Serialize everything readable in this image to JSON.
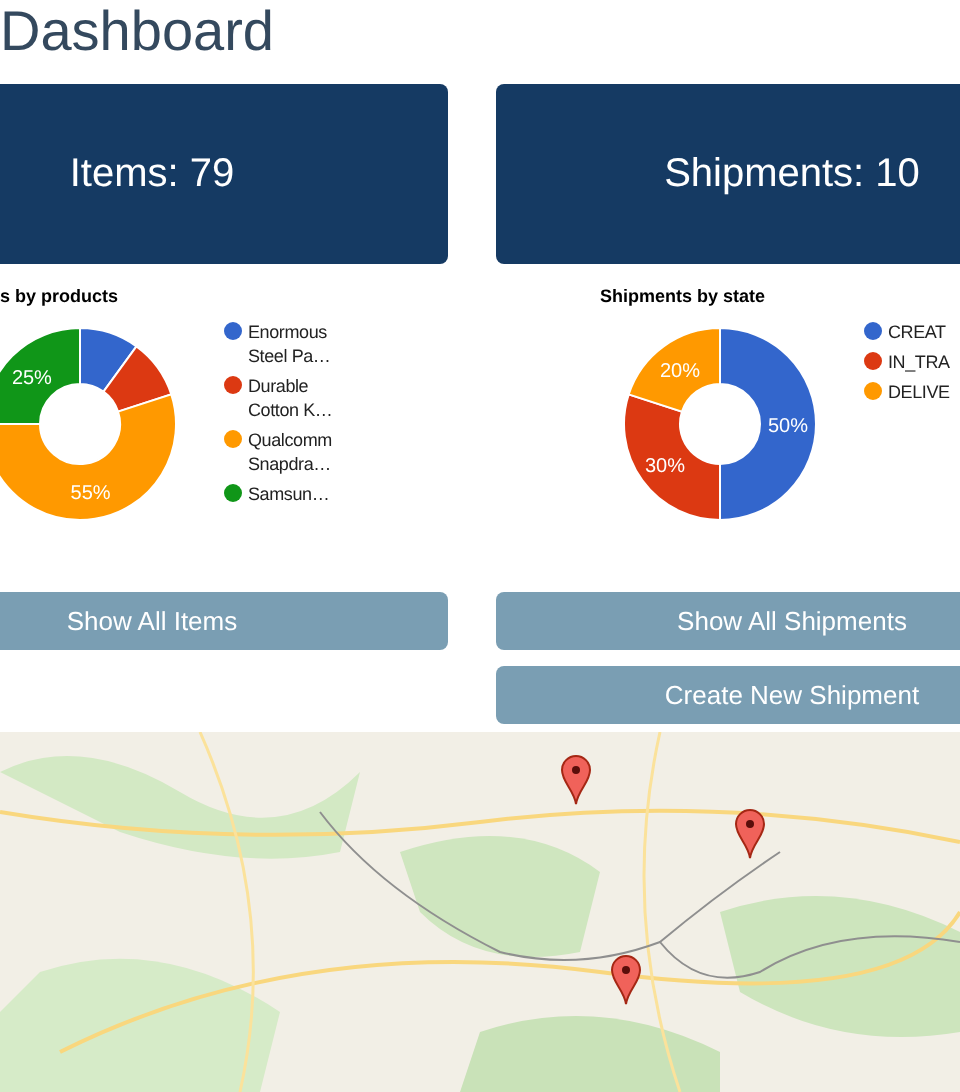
{
  "title": "Dashboard",
  "columns": [
    {
      "summary": "Items: 79",
      "chart_data": {
        "type": "donut",
        "title": "s by products",
        "categories": [
          "Enormous Steel Pa…",
          "Durable Cotton K…",
          "Qualcomm Snapdra…",
          "Samsun…"
        ],
        "values": [
          10,
          10,
          55,
          25
        ],
        "colors": [
          "#3366cc",
          "#dc3912",
          "#ff9900",
          "#109618"
        ],
        "value_labels": [
          null,
          null,
          "55%",
          "25%"
        ]
      },
      "buttons": [
        "Show All Items"
      ]
    },
    {
      "summary": "Shipments: 10",
      "chart_data": {
        "type": "donut",
        "title": "Shipments by state",
        "categories": [
          "CREAT",
          "IN_TRA",
          "DELIVE"
        ],
        "values": [
          50,
          30,
          20
        ],
        "colors": [
          "#3366cc",
          "#dc3912",
          "#ff9900"
        ],
        "value_labels": [
          "50%",
          "30%",
          "20%"
        ]
      },
      "buttons": [
        "Show All Shipments",
        "Create New Shipment"
      ]
    }
  ]
}
